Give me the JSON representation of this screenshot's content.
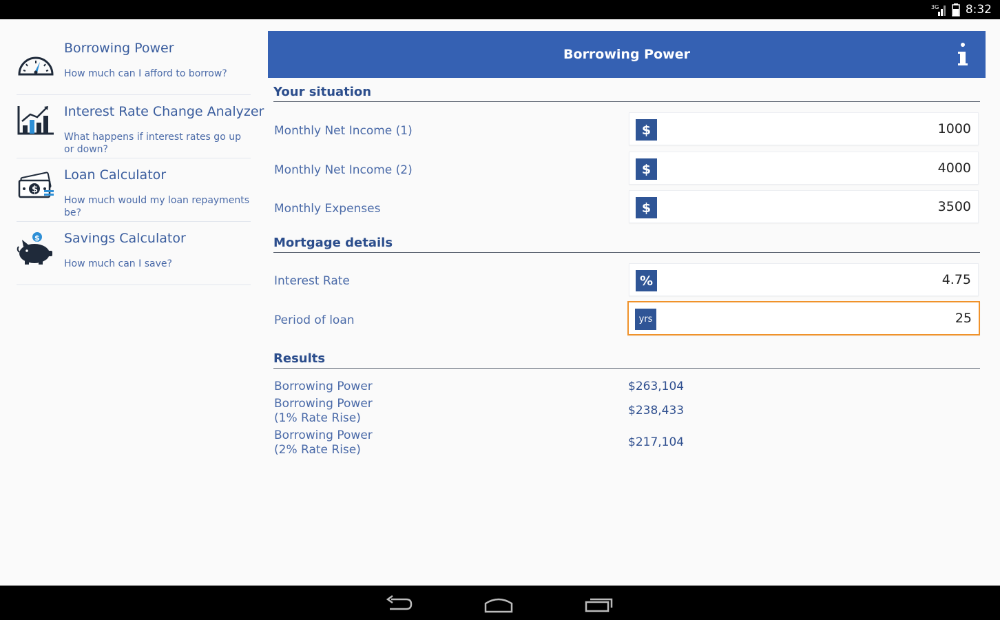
{
  "status_bar": {
    "network": "3G",
    "time": "8:32"
  },
  "sidebar": {
    "items": [
      {
        "title": "Borrowing Power",
        "subtitle": "How much can I afford to borrow?",
        "icon": "speedometer-icon"
      },
      {
        "title": "Interest Rate Change Analyzer",
        "subtitle": "What happens if interest rates go up or down?",
        "icon": "bar-chart-icon"
      },
      {
        "title": "Loan Calculator",
        "subtitle": "How much would my loan repayments be?",
        "icon": "money-icon"
      },
      {
        "title": "Savings Calculator",
        "subtitle": "How much can I save?",
        "icon": "piggy-bank-icon"
      }
    ]
  },
  "header": {
    "title": "Borrowing Power",
    "info_icon": "info-icon"
  },
  "your_situation": {
    "title": "Your situation",
    "rows": [
      {
        "label": "Monthly Net Income (1)",
        "unit": "$",
        "value": "1000"
      },
      {
        "label": "Monthly Net Income (2)",
        "unit": "$",
        "value": "4000"
      },
      {
        "label": "Monthly Expenses",
        "unit": "$",
        "value": "3500"
      }
    ]
  },
  "mortgage_details": {
    "title": "Mortgage details",
    "rows": [
      {
        "label": "Interest Rate",
        "unit": "%",
        "value": "4.75"
      },
      {
        "label": "Period of loan",
        "unit": "yrs",
        "value": "25"
      }
    ]
  },
  "results": {
    "title": "Results",
    "rows": [
      {
        "label": "Borrowing Power",
        "value": "$263,104"
      },
      {
        "label": "Borrowing Power\n(1% Rate Rise)",
        "value": "$238,433"
      },
      {
        "label": "Borrowing Power\n(2% Rate Rise)",
        "value": "$217,104"
      }
    ]
  },
  "colors": {
    "header_blue": "#3561b3",
    "badge_blue": "#2f5596",
    "focus_orange": "#f0922a",
    "text_blue": "#4a6aa8"
  }
}
